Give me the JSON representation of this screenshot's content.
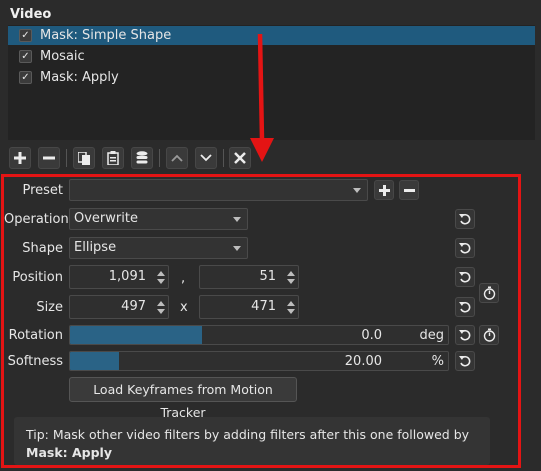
{
  "header": {
    "title": "Video"
  },
  "filters": [
    {
      "label": "Mask: Simple Shape",
      "checked": true,
      "selected": true
    },
    {
      "label": "Mosaic",
      "checked": true,
      "selected": false
    },
    {
      "label": "Mask: Apply",
      "checked": true,
      "selected": false
    }
  ],
  "toolbar": {
    "add_icon": "plus-icon",
    "remove_icon": "minus-icon",
    "copy_icon": "copy-icon",
    "paste_icon": "paste-icon",
    "save_icon": "database-icon",
    "up_icon": "chevron-up-icon",
    "down_icon": "chevron-down-icon",
    "close_icon": "close-icon"
  },
  "annotation": {
    "color": "#e41414"
  },
  "params": {
    "preset": {
      "label": "Preset",
      "value": ""
    },
    "operation": {
      "label": "Operation",
      "value": "Overwrite"
    },
    "shape": {
      "label": "Shape",
      "value": "Ellipse"
    },
    "position": {
      "label": "Position",
      "x": "1,091",
      "sep": ",",
      "y": "51"
    },
    "size": {
      "label": "Size",
      "w": "497",
      "sep": "x",
      "h": "471"
    },
    "rotation": {
      "label": "Rotation",
      "value": "0.0",
      "unit": "deg",
      "fill_fraction": 0.35
    },
    "softness": {
      "label": "Softness",
      "value": "20.00",
      "unit": "%",
      "fill_fraction": 0.13
    }
  },
  "load_button": "Load Keyframes from Motion Tracker",
  "tip": {
    "prefix": "Tip: Mask other video filters by adding filters after this one followed by ",
    "bold": "Mask: Apply"
  },
  "colors": {
    "selection": "#1f5a7e",
    "slider_fill": "#2a6386",
    "background": "#2b2b2b"
  }
}
